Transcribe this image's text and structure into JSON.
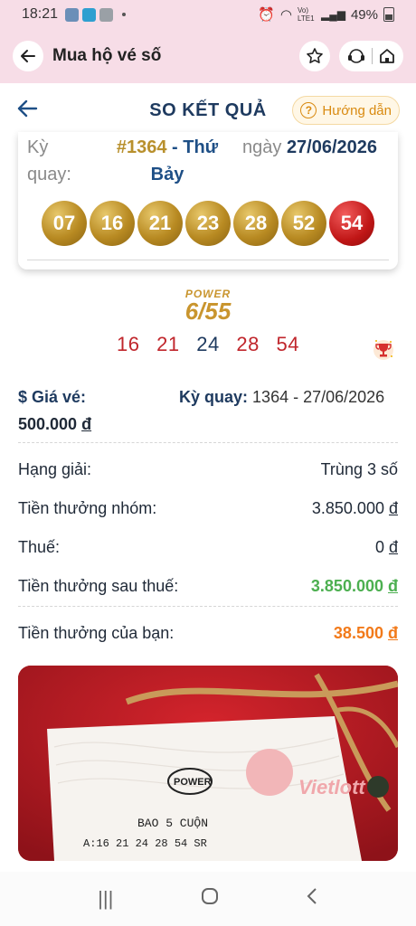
{
  "status_bar": {
    "time": "18:21",
    "network": "Vo) LTE1",
    "battery": "49%"
  },
  "app_bar": {
    "title": "Mua hộ vé số"
  },
  "header": {
    "title": "SO KẾT QUẢ",
    "help_label": "Hướng dẫn"
  },
  "draw": {
    "ky_label": "Kỳ quay:",
    "draw_number": "#1364",
    "draw_day": "- Thứ Bảy",
    "date_label": "ngày",
    "date_value": "27/06/2026",
    "balls": [
      "07",
      "16",
      "21",
      "23",
      "28",
      "52"
    ],
    "special_ball": "54"
  },
  "product": {
    "logo_top": "POWER",
    "logo_main": "6/55"
  },
  "ticket": {
    "numbers": [
      "16",
      "21",
      "24",
      "28",
      "54"
    ]
  },
  "info": {
    "price_label": "$ Giá vé:",
    "price_value": "500.000",
    "currency": "đ",
    "ky_quay_label": "Kỳ quay:",
    "ky_quay_value": "1364 - 27/06/2026"
  },
  "prize_rows": [
    {
      "label": "Hạng giải:",
      "value": "Trùng 3 số",
      "unit": ""
    },
    {
      "label": "Tiền thưởng nhóm:",
      "value": "3.850.000",
      "unit": "đ"
    },
    {
      "label": "Thuế:",
      "value": "0",
      "unit": "đ"
    },
    {
      "label": "Tiền thưởng sau thuế:",
      "value": "3.850.000",
      "unit": "đ"
    }
  ],
  "your_prize": {
    "label": "Tiền thưởng của bạn:",
    "value": "38.500",
    "unit": "đ"
  },
  "photo": {
    "ticket_brand": "Vietlott",
    "ticket_logo": "POWER",
    "ticket_line1": "BAO 5 CUỘN",
    "ticket_line2": "A:16 21 24 28 54 SR"
  },
  "colors": {
    "app_bar_bg": "#f7dde7",
    "navy": "#1e3a5f",
    "gold": "#c9952e",
    "red": "#c0262c",
    "green": "#4caf50",
    "orange": "#f27a1a"
  }
}
